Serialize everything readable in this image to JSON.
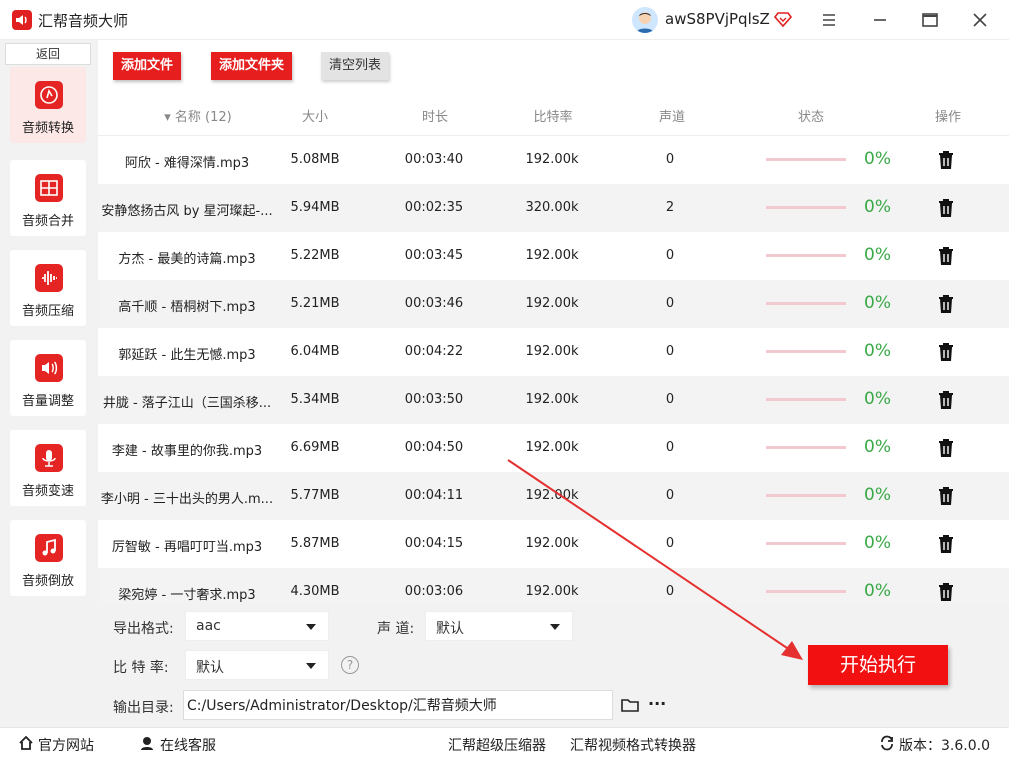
{
  "app": {
    "title": "汇帮音频大师",
    "username": "awS8PVjPqlsZ"
  },
  "sidebar": {
    "back_label": "返回",
    "items": [
      {
        "label": "音频转换"
      },
      {
        "label": "音频合并"
      },
      {
        "label": "音频压缩"
      },
      {
        "label": "音量调整"
      },
      {
        "label": "音频变速"
      },
      {
        "label": "音频倒放"
      }
    ]
  },
  "toolbar": {
    "add_file": "添加文件",
    "add_folder": "添加文件夹",
    "clear_list": "清空列表"
  },
  "table": {
    "headers": {
      "name": "▾ 名称 (12)",
      "size": "大小",
      "duration": "时长",
      "bitrate": "比特率",
      "channels": "声道",
      "status": "状态",
      "action": "操作"
    },
    "rows": [
      {
        "name": "阿欣 - 难得深情.mp3",
        "size": "5.08MB",
        "duration": "00:03:40",
        "bitrate": "192.00k",
        "channels": "0",
        "progress": "0%"
      },
      {
        "name": "安静悠扬古风 by 星河璨起-...",
        "size": "5.94MB",
        "duration": "00:02:35",
        "bitrate": "320.00k",
        "channels": "2",
        "progress": "0%"
      },
      {
        "name": "方杰 - 最美的诗篇.mp3",
        "size": "5.22MB",
        "duration": "00:03:45",
        "bitrate": "192.00k",
        "channels": "0",
        "progress": "0%"
      },
      {
        "name": "高千顺 - 梧桐树下.mp3",
        "size": "5.21MB",
        "duration": "00:03:46",
        "bitrate": "192.00k",
        "channels": "0",
        "progress": "0%"
      },
      {
        "name": "郭延跃 - 此生无憾.mp3",
        "size": "6.04MB",
        "duration": "00:04:22",
        "bitrate": "192.00k",
        "channels": "0",
        "progress": "0%"
      },
      {
        "name": "井胧 - 落子江山（三国杀移...",
        "size": "5.34MB",
        "duration": "00:03:50",
        "bitrate": "192.00k",
        "channels": "0",
        "progress": "0%"
      },
      {
        "name": "李建 - 故事里的你我.mp3",
        "size": "6.69MB",
        "duration": "00:04:50",
        "bitrate": "192.00k",
        "channels": "0",
        "progress": "0%"
      },
      {
        "name": "李小明 - 三十出头的男人.m...",
        "size": "5.77MB",
        "duration": "00:04:11",
        "bitrate": "192.00k",
        "channels": "0",
        "progress": "0%"
      },
      {
        "name": "厉智敏 - 再唱叮叮当.mp3",
        "size": "5.87MB",
        "duration": "00:04:15",
        "bitrate": "192.00k",
        "channels": "0",
        "progress": "0%"
      },
      {
        "name": "梁宛婷 - 一寸奢求.mp3",
        "size": "4.30MB",
        "duration": "00:03:06",
        "bitrate": "192.00k",
        "channels": "0",
        "progress": "0%"
      }
    ]
  },
  "settings": {
    "format_label": "导出格式:",
    "format_value": "aac",
    "channel_label": "声 道:",
    "channel_value": "默认",
    "bitrate_label": "比 特 率:",
    "bitrate_value": "默认",
    "help": "?",
    "output_label": "输出目录:",
    "output_path": "C:/Users/Administrator/Desktop/汇帮音频大师",
    "more": "···"
  },
  "start_button": "开始执行",
  "footer": {
    "website": "官方网站",
    "support": "在线客服",
    "compressor": "汇帮超级压缩器",
    "converter": "汇帮视频格式转换器",
    "version": "版本：3.6.0.0"
  },
  "colors": {
    "accent": "#e61e1e",
    "progress_text": "#3aa845",
    "progress_track": "#f2c9cf"
  }
}
